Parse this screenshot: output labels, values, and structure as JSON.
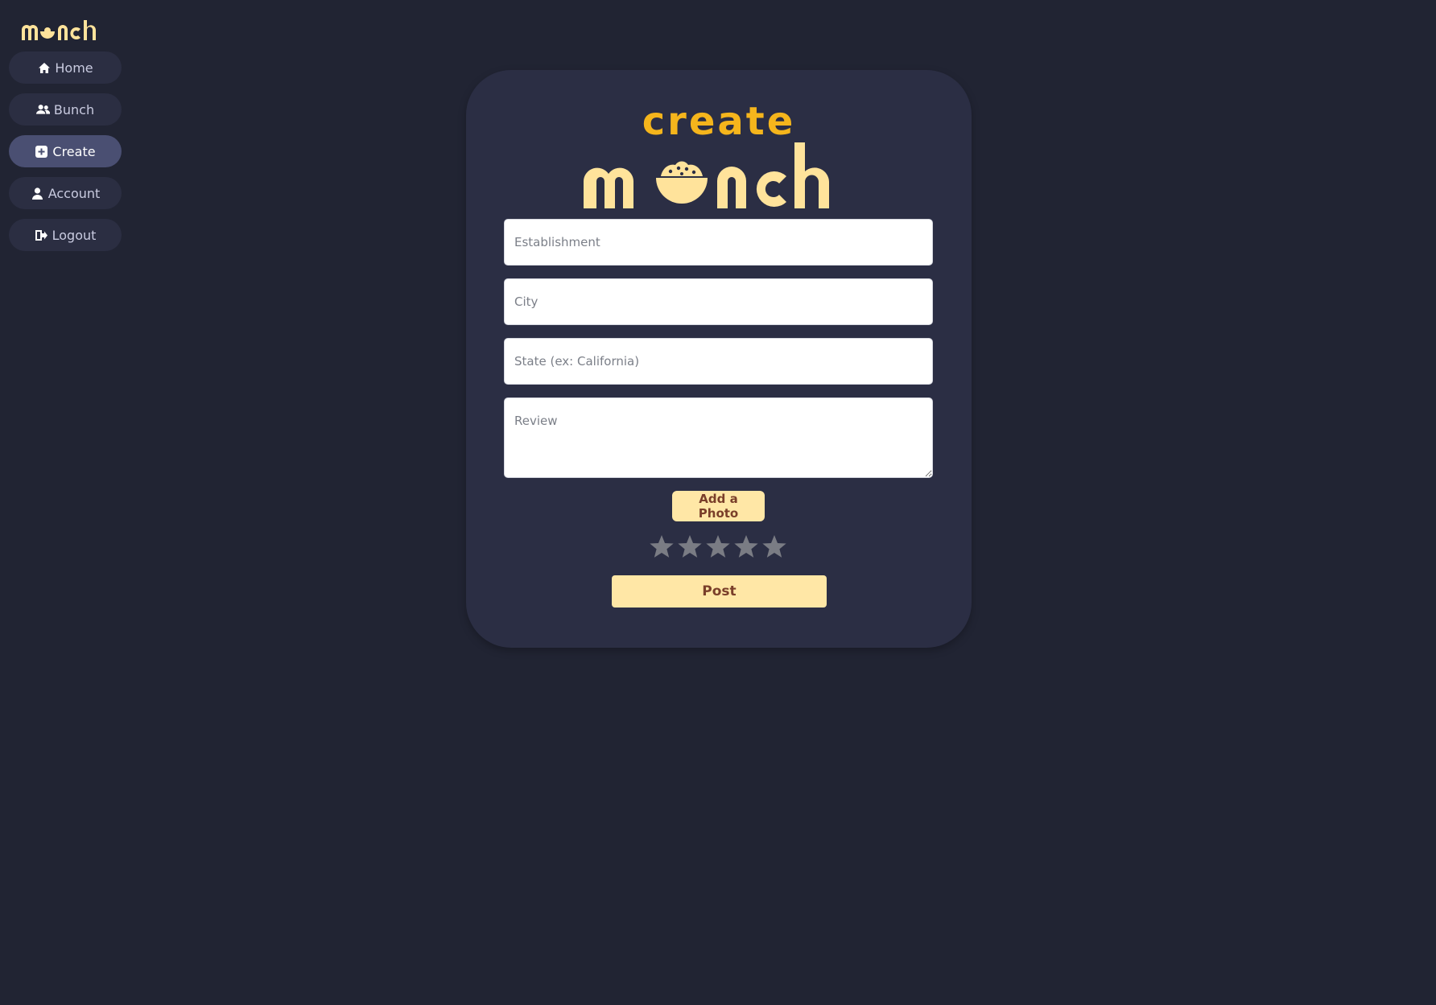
{
  "sidebar": {
    "brand": "munch",
    "items": [
      {
        "label": "Home",
        "icon": "home-icon"
      },
      {
        "label": "Bunch",
        "icon": "users-icon"
      },
      {
        "label": "Create",
        "icon": "plus-square-icon",
        "active": true
      },
      {
        "label": "Account",
        "icon": "user-icon"
      },
      {
        "label": "Logout",
        "icon": "logout-icon"
      }
    ]
  },
  "form": {
    "heading_small": "create",
    "heading_logo": "munch",
    "establishment_placeholder": "Establishment",
    "city_placeholder": "City",
    "state_placeholder": "State (ex: California)",
    "review_placeholder": "Review",
    "photo_button": "Add a Photo",
    "rating_max": 5,
    "rating_value": 0,
    "post_button": "Post"
  },
  "colors": {
    "background": "#212433",
    "card": "#2b2e44",
    "brand_yellow": "#f5b51c",
    "logo_cream": "#ffe39b",
    "button_bg": "#ffe7a6",
    "button_text": "#7a3f2a",
    "star_empty": "#7a7c84"
  }
}
